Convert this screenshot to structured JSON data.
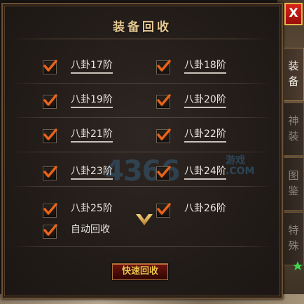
{
  "window": {
    "title": "装备回收",
    "close_label": "X"
  },
  "tabs": [
    {
      "label_line1": "装",
      "label_line2": "备",
      "active": true
    },
    {
      "label_line1": "神",
      "label_line2": "装",
      "active": false
    },
    {
      "label_line1": "图",
      "label_line2": "鉴",
      "active": false
    },
    {
      "label_line1": "特",
      "label_line2": "殊",
      "active": false
    }
  ],
  "options": [
    {
      "label": "八卦17阶",
      "checked": true
    },
    {
      "label": "八卦18阶",
      "checked": true
    },
    {
      "label": "八卦19阶",
      "checked": true
    },
    {
      "label": "八卦20阶",
      "checked": true
    },
    {
      "label": "八卦21阶",
      "checked": true
    },
    {
      "label": "八卦22阶",
      "checked": true
    },
    {
      "label": "八卦23阶",
      "checked": true
    },
    {
      "label": "八卦24阶",
      "checked": true
    },
    {
      "label": "八卦25阶",
      "checked": true
    },
    {
      "label": "八卦26阶",
      "checked": true
    }
  ],
  "auto_recycle": {
    "label": "自动回收",
    "checked": true
  },
  "quick_button": {
    "label": "快速回收"
  },
  "watermark": {
    "text": "4366",
    "sub": "游戏",
    "domain": ".COM"
  },
  "colors": {
    "title": "#e6c891",
    "check": "#e8631a",
    "button_text": "#f2c24a"
  }
}
